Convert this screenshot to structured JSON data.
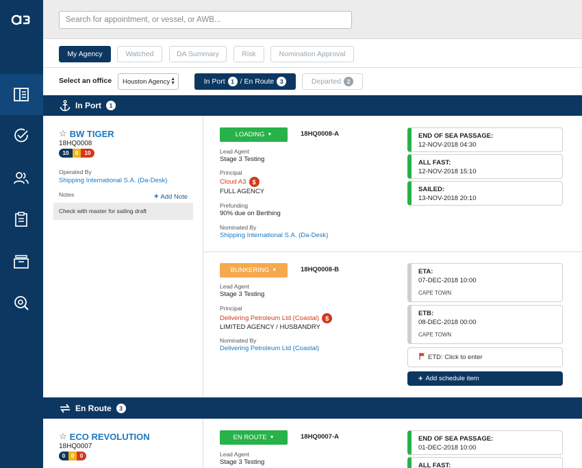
{
  "logo": "a3",
  "search": {
    "placeholder": "Search for appointment, or vessel, or AWB..."
  },
  "sidebar": {
    "icons": [
      "dashboard-icon",
      "checkmark-icon",
      "people-icon",
      "clipboard-icon",
      "archive-icon",
      "search-settings-icon"
    ]
  },
  "tabs": [
    "My Agency",
    "Watched",
    "DA Summary",
    "Risk",
    "Nomination Approval"
  ],
  "office": {
    "label": "Select an office",
    "selected": "Houston Agency"
  },
  "toggle": {
    "in_port": "In Port",
    "in_port_count": "1",
    "sep": "/ En Route",
    "en_route_count": "3",
    "departed": "Departed",
    "departed_count": "2"
  },
  "sections": {
    "in_port": {
      "title": "In Port",
      "count": "1"
    },
    "en_route": {
      "title": "En Route",
      "count": "3"
    }
  },
  "vessel1": {
    "name": "BW TIGER",
    "code": "18HQ0008",
    "pills": [
      "10",
      "0",
      "10"
    ],
    "operated_by_label": "Operated By",
    "operated_by": "Shipping International S.A. (Da-Desk)",
    "notes_label": "Notes",
    "add_note": "Add Note",
    "note_text": "Check with master for sailing draft"
  },
  "appt_a": {
    "status": "LOADING",
    "code": "18HQ0008-A",
    "lead_agent_label": "Lead Agent",
    "lead_agent": "Stage 3 Testing",
    "principal_label": "Principal",
    "principal": "Cloud A3",
    "agency_type": "FULL AGENCY",
    "prefunding_label": "Prefunding",
    "prefunding": "90% due on Berthing",
    "nominated_label": "Nominated By",
    "nominated": "Shipping International S.A. (Da-Desk)"
  },
  "sched_a": [
    {
      "title": "END OF SEA PASSAGE:",
      "date": "12-NOV-2018 04:30"
    },
    {
      "title": "ALL FAST:",
      "date": "12-NOV-2018 15:10"
    },
    {
      "title": "SAILED:",
      "date": "13-NOV-2018 20:10"
    }
  ],
  "appt_b": {
    "status": "BUNKERING",
    "code": "18HQ0008-B",
    "lead_agent_label": "Lead Agent",
    "lead_agent": "Stage 3 Testing",
    "principal_label": "Principal",
    "principal": "Delivering Petroleum Ltd (Coastal)",
    "agency_type": "LIMITED AGENCY / HUSBANDRY",
    "nominated_label": "Nominated By",
    "nominated": "Delivering Petroleum Ltd (Coastal)"
  },
  "sched_b": [
    {
      "title": "ETA:",
      "date": "07-DEC-2018 10:00",
      "port": "CAPE TOWN"
    },
    {
      "title": "ETB:",
      "date": "08-DEC-2018 00:00",
      "port": "CAPE TOWN"
    }
  ],
  "etd": "ETD: Click to enter",
  "add_schedule": "Add schedule item",
  "vessel2": {
    "name": "ECO REVOLUTION",
    "code": "18HQ0007",
    "pills": [
      "0",
      "0",
      "0"
    ]
  },
  "appt_c": {
    "status": "EN ROUTE",
    "code": "18HQ0007-A",
    "lead_agent_label": "Lead Agent",
    "lead_agent": "Stage 3 Testing"
  },
  "sched_c": [
    {
      "title": "END OF SEA PASSAGE:",
      "date": "01-DEC-2018 10:00"
    },
    {
      "title": "ALL FAST:",
      "date": ""
    }
  ],
  "colors": {
    "navy": "#0c3761",
    "green": "#27b24a",
    "orange": "#f5a94c",
    "pill_navy": "#0c3761",
    "pill_yellow": "#f2b21b",
    "pill_red": "#d23a1e",
    "link": "#1a78c2"
  }
}
